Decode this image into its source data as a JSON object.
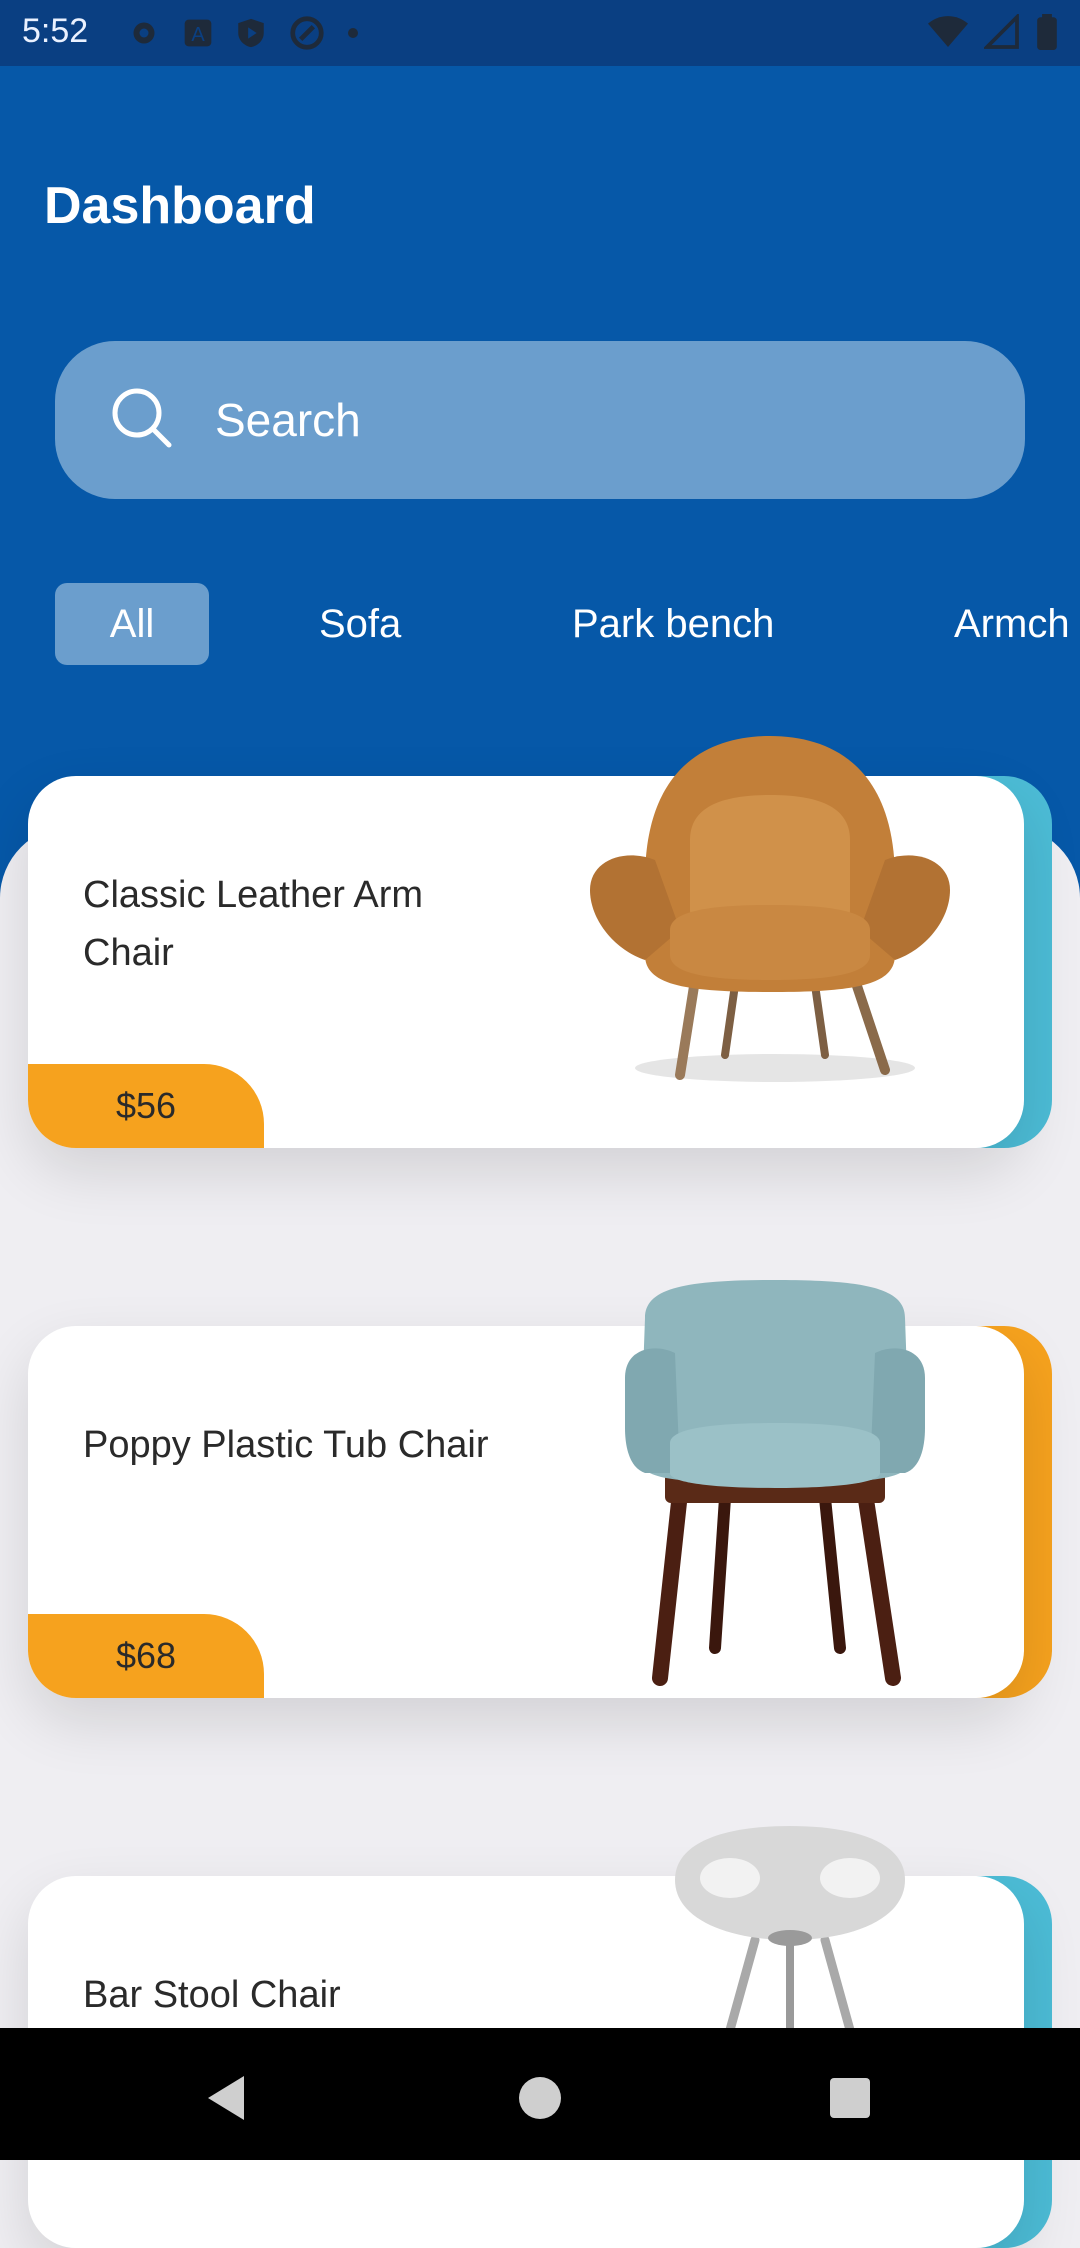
{
  "status_bar": {
    "time": "5:52"
  },
  "header": {
    "title": "Dashboard"
  },
  "search": {
    "placeholder": "Search"
  },
  "tabs": [
    {
      "label": "All",
      "active": true
    },
    {
      "label": "Sofa",
      "active": false
    },
    {
      "label": "Park bench",
      "active": false
    },
    {
      "label": "Armch",
      "active": false
    }
  ],
  "products": [
    {
      "name": "Classic Leather Arm Chair",
      "price": "$56",
      "accent_color": "#4cbcd6"
    },
    {
      "name": "Poppy Plastic Tub Chair",
      "price": "$68",
      "accent_color": "#f6a21e"
    },
    {
      "name": "Bar Stool Chair",
      "accent_color": "#4cbcd6"
    }
  ],
  "colors": {
    "primary": "#0658a8",
    "search_bg": "#6b9ecd",
    "price_badge": "#f6a21e",
    "background": "#efeef2"
  }
}
